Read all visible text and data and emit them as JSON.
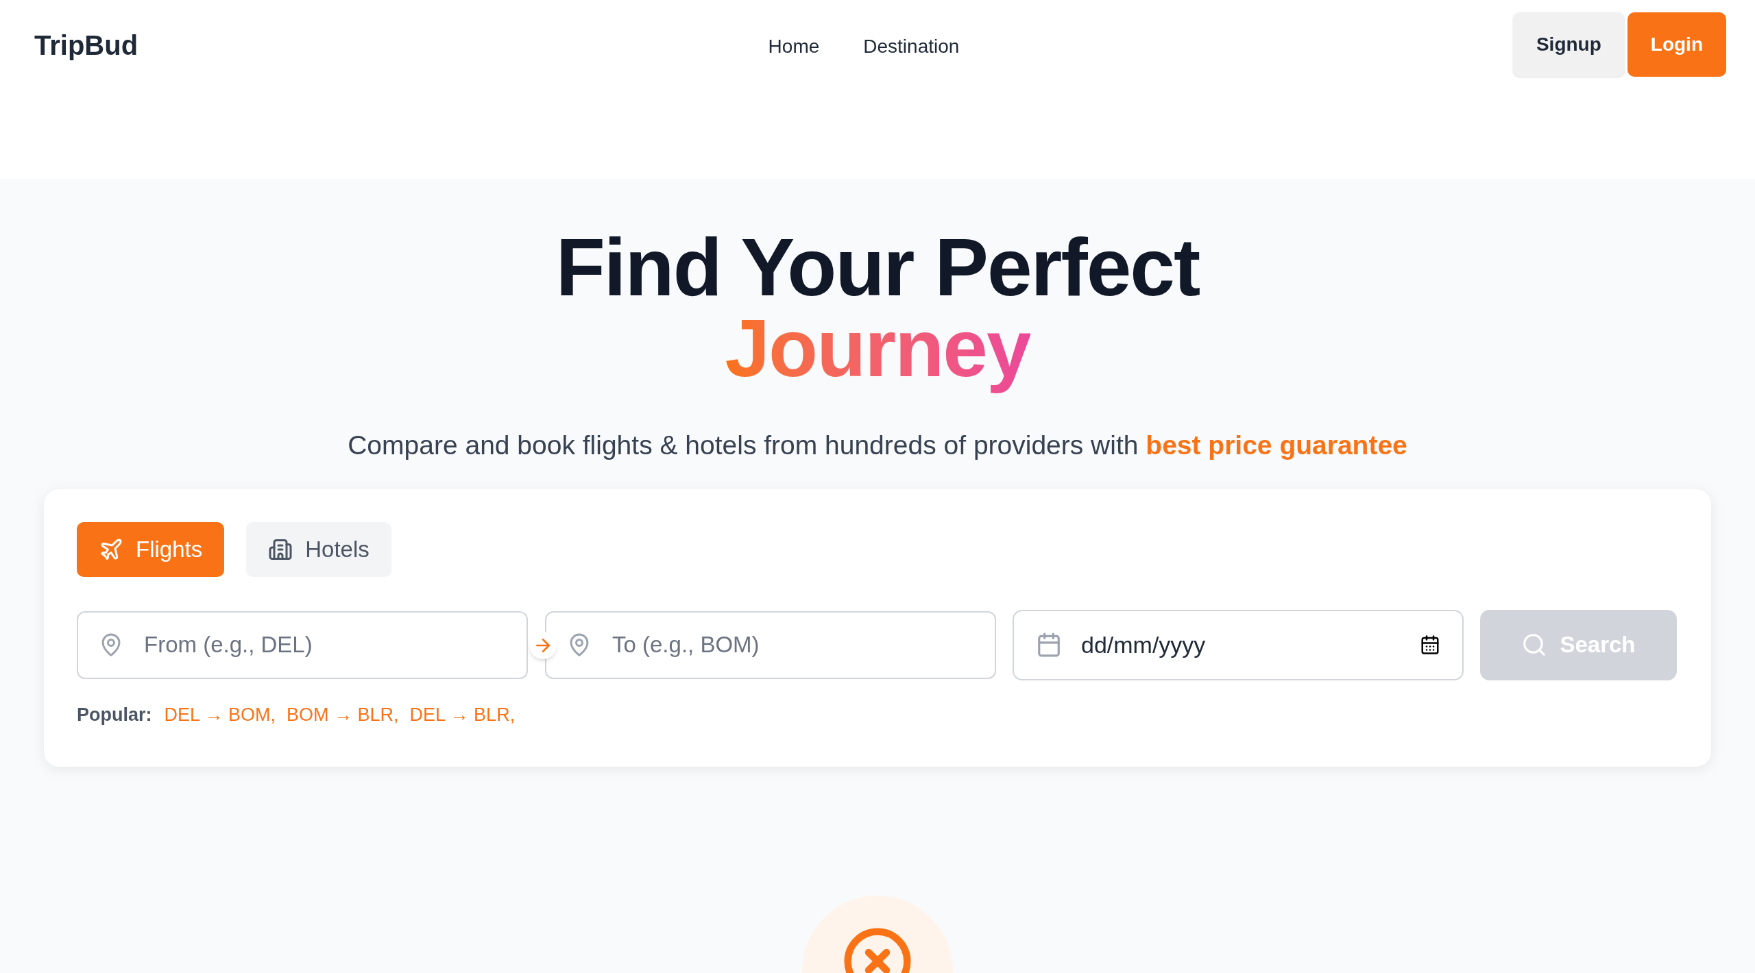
{
  "header": {
    "logo": "TripBud",
    "nav": [
      "Home",
      "Destination"
    ],
    "buttons": [
      {
        "label": "Signup",
        "kind": "secondary"
      },
      {
        "label": "Login",
        "kind": "primary"
      }
    ]
  },
  "hero": {
    "title": "Find Your Perfect",
    "title_highlight": "Journey",
    "subtitle": "Compare and book flights & hotels from hundreds of providers with",
    "subtitle_highlight": "best price guarantee"
  },
  "search": {
    "tabs": [
      {
        "label": "Flights",
        "kind": "flight",
        "selected": true
      },
      {
        "label": "Hotels",
        "kind": "hotel",
        "selected": false
      }
    ],
    "from": {
      "placeholder": "From (e.g., DEL)"
    },
    "to": {
      "placeholder": "To (e.g., BOM)"
    },
    "date": {
      "placeholder": "dd/mm/yyyy"
    },
    "search_button": {
      "label": "Search",
      "disabled": true
    },
    "popular": {
      "label": "Popular:",
      "routes": [
        "DEL → BOM,",
        "BOM → BLR,",
        "DEL → BLR,"
      ]
    }
  }
}
